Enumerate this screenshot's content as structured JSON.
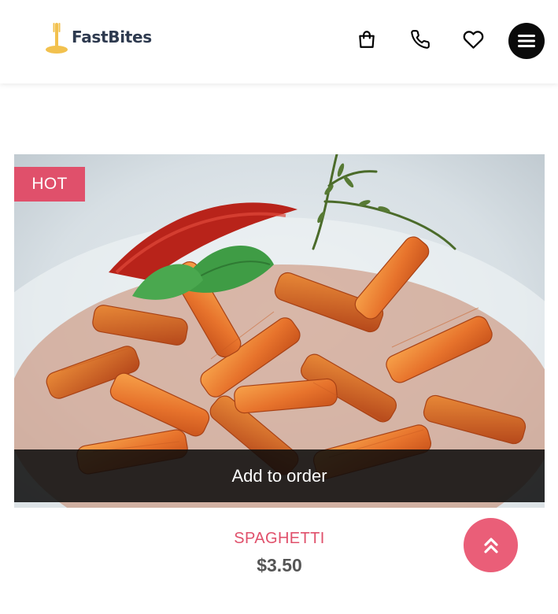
{
  "header": {
    "brand_name": "FastBites",
    "icons": {
      "cart": "shopping-bag-icon",
      "phone": "phone-icon",
      "wishlist": "heart-icon",
      "menu": "hamburger-menu-icon"
    }
  },
  "product": {
    "badge": "HOT",
    "image_alt": "penne pasta with tomato sauce, basil and red chili",
    "add_to_order_label": "Add to order",
    "name": "SPAGHETTI",
    "price": "$3.50"
  },
  "scroll_top": {
    "icon": "double-chevron-up-icon"
  },
  "colors": {
    "accent": "#e0506b",
    "scroll_button": "#ea5e78",
    "logo_fork": "#f2c14e",
    "text_dark": "#2e3a4f",
    "price_text": "#555555",
    "menu_button": "#0a0a0a"
  }
}
